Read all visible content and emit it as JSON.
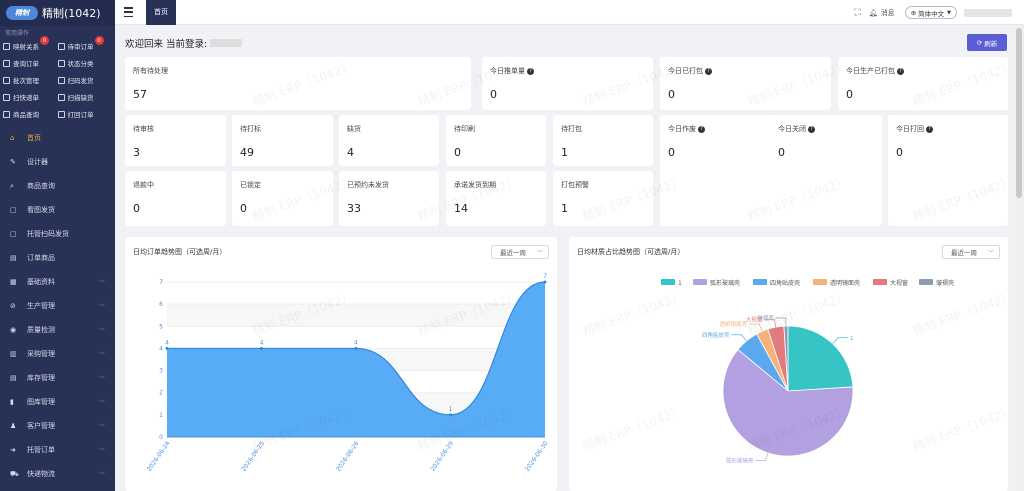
{
  "app": {
    "logo_text": "精制",
    "title": "精制(1042)"
  },
  "sidebar": {
    "common_title": "常用操作",
    "quick_actions": [
      {
        "label": "映射关系",
        "badge": "0"
      },
      {
        "label": "待审订单",
        "badge": "0"
      },
      {
        "label": "查询订单"
      },
      {
        "label": "状态分类"
      },
      {
        "label": "批次管理"
      },
      {
        "label": "扫码发货"
      },
      {
        "label": "扫快递单"
      },
      {
        "label": "扫描缺货"
      },
      {
        "label": "商品查询"
      },
      {
        "label": "打回订单"
      }
    ],
    "menu": [
      {
        "label": "首页",
        "active": true
      },
      {
        "label": "设计器"
      },
      {
        "label": "商品查询"
      },
      {
        "label": "看图发货"
      },
      {
        "label": "托管扫码发货"
      },
      {
        "label": "订单商品"
      },
      {
        "label": "基础资料",
        "chevron": "﹀"
      },
      {
        "label": "生产管理",
        "chevron": "﹀"
      },
      {
        "label": "质量检测",
        "chevron": "﹀"
      },
      {
        "label": "采购管理",
        "chevron": "﹀"
      },
      {
        "label": "库存管理",
        "chevron": "﹀"
      },
      {
        "label": "图库管理",
        "chevron": "﹀"
      },
      {
        "label": "客户管理",
        "chevron": "﹀"
      },
      {
        "label": "托管订单",
        "chevron": "﹀"
      },
      {
        "label": "快递物流",
        "chevron": "﹀"
      }
    ]
  },
  "topbar": {
    "tab_label": "首页",
    "message_label": "消息",
    "language": "简体中文"
  },
  "main": {
    "welcome": "欢迎回来 当前登录:",
    "refresh_label": "刷新",
    "watermark": "精制 ERP（1042）",
    "stats": [
      {
        "label": "所有待处理",
        "value": "57"
      },
      {
        "label": "今日推单量",
        "value": "0",
        "help": "?"
      },
      {
        "label": "今日已打包",
        "value": "0",
        "help": "?"
      },
      {
        "label": "今日生产已打包",
        "value": "0",
        "help": "?"
      },
      {
        "label": "待审核",
        "value": "3"
      },
      {
        "label": "待打标",
        "value": "49"
      },
      {
        "label": "缺货",
        "value": "4"
      },
      {
        "label": "待印刷",
        "value": "0"
      },
      {
        "label": "待打包",
        "value": "1"
      },
      {
        "label": "今日作废",
        "value": "0",
        "help": "?"
      },
      {
        "label": "今日关闭",
        "value": "0",
        "help": "?"
      },
      {
        "label": "今日打回",
        "value": "0",
        "help": "?"
      },
      {
        "label": "退款中",
        "value": "0"
      },
      {
        "label": "已锁定",
        "value": "0"
      },
      {
        "label": "已预约未发货",
        "value": "33"
      },
      {
        "label": "承诺发货到期",
        "value": "14"
      },
      {
        "label": "打包预警",
        "value": "1"
      }
    ],
    "left_panel": {
      "title": "日均订单趋势图（可选周/月）",
      "select": "最近一周"
    },
    "right_panel": {
      "title": "日均材质占比趋势图（可选周/月）",
      "select": "最近一周"
    }
  },
  "chart_data": [
    {
      "type": "area",
      "title": "日均订单趋势图（可选周/月）",
      "categories": [
        "2026-06-24",
        "2026-06-25",
        "2026-06-26",
        "2026-06-29",
        "2026-06-30"
      ],
      "series": [
        {
          "values": [
            4,
            4,
            4,
            1,
            7
          ]
        }
      ],
      "ylim": [
        0,
        7
      ],
      "yticks": [
        "0",
        "1",
        "2",
        "3",
        "4",
        "5",
        "6",
        "7"
      ],
      "color": "#4fa8f5",
      "grid": true
    },
    {
      "type": "pie",
      "title": "日均材质占比趋势图（可选周/月）",
      "legend_position": "top",
      "slices": [
        {
          "name": "1",
          "value": 24,
          "color": "#36c4c4"
        },
        {
          "name": "弧形玻璃壳",
          "value": 62,
          "color": "#b3a0e0"
        },
        {
          "name": "四角贴皮壳",
          "value": 6,
          "color": "#5aa8ee"
        },
        {
          "name": "透明镜面壳",
          "value": 3,
          "color": "#f7b27a"
        },
        {
          "name": "大视窗",
          "value": 4,
          "color": "#e07b80"
        },
        {
          "name": "皱褶壳",
          "value": 1,
          "color": "#8e9bb5"
        }
      ]
    }
  ]
}
